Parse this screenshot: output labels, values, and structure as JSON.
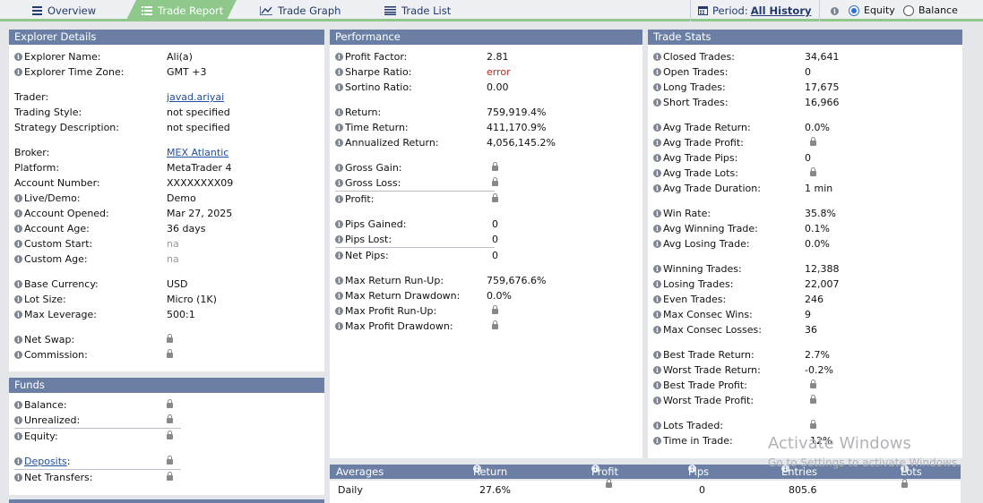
{
  "tabs": {
    "overview": "Overview",
    "trade_report": "Trade Report",
    "trade_graph": "Trade Graph",
    "trade_list": "Trade List"
  },
  "period": {
    "label": "Period:",
    "value": "All History"
  },
  "mode": {
    "equity": "Equity",
    "balance": "Balance",
    "selected": "Equity"
  },
  "explorer": {
    "title": "Explorer Details",
    "rows": {
      "explorer_name": {
        "label": "Explorer Name:",
        "value": "Ali(a)"
      },
      "explorer_tz": {
        "label": "Explorer Time Zone:",
        "value": "GMT +3"
      },
      "trader": {
        "label": "Trader:",
        "value": "javad.ariyai"
      },
      "style": {
        "label": "Trading Style:",
        "value": "not specified"
      },
      "strategy": {
        "label": "Strategy Description:",
        "value": "not specified"
      },
      "broker": {
        "label": "Broker:",
        "value": "MEX Atlantic"
      },
      "platform": {
        "label": "Platform:",
        "value": "MetaTrader 4"
      },
      "account_number": {
        "label": "Account Number:",
        "value": "XXXXXXXX09"
      },
      "live_demo": {
        "label": "Live/Demo:",
        "value": "Demo"
      },
      "opened": {
        "label": "Account Opened:",
        "value": "Mar 27, 2025"
      },
      "age": {
        "label": "Account Age:",
        "value": "36 days"
      },
      "custom_start": {
        "label": "Custom Start:",
        "value": "na"
      },
      "custom_age": {
        "label": "Custom Age:",
        "value": "na"
      },
      "base_currency": {
        "label": "Base Currency:",
        "value": "USD"
      },
      "lot_size": {
        "label": "Lot Size:",
        "value": "Micro (1K)"
      },
      "max_leverage": {
        "label": "Max Leverage:",
        "value": "500:1"
      },
      "net_swap": {
        "label": "Net Swap:"
      },
      "commission": {
        "label": "Commission:"
      }
    }
  },
  "funds": {
    "title": "Funds",
    "balance": "Balance:",
    "unrealized": "Unrealized:",
    "equity": "Equity:",
    "deposits": "Deposits",
    "deposits_colon": ":",
    "net_transfers": "Net Transfers:"
  },
  "performance": {
    "title": "Performance",
    "rows": {
      "profit_factor": {
        "label": "Profit Factor:",
        "value": "2.81"
      },
      "sharpe": {
        "label": "Sharpe Ratio:",
        "value": "error"
      },
      "sortino": {
        "label": "Sortino Ratio:",
        "value": "0.00"
      },
      "return": {
        "label": "Return:",
        "value": "759,919.4%"
      },
      "time_return": {
        "label": "Time Return:",
        "value": "411,170.9%"
      },
      "annualized": {
        "label": "Annualized Return:",
        "value": "4,056,145.2%"
      },
      "gross_gain": {
        "label": "Gross Gain:"
      },
      "gross_loss": {
        "label": "Gross Loss:"
      },
      "profit": {
        "label": "Profit:"
      },
      "pips_gained": {
        "label": "Pips Gained:",
        "value": "0"
      },
      "pips_lost": {
        "label": "Pips Lost:",
        "value": "0"
      },
      "net_pips": {
        "label": "Net Pips:",
        "value": "0"
      },
      "max_runup": {
        "label": "Max Return Run-Up:",
        "value": "759,676.6%"
      },
      "max_drawdown": {
        "label": "Max Return Drawdown:",
        "value": "0.0%"
      },
      "max_profit_runup": {
        "label": "Max Profit Run-Up:"
      },
      "max_profit_drawdown": {
        "label": "Max Profit Drawdown:"
      }
    }
  },
  "stats": {
    "title": "Trade Stats",
    "rows": {
      "closed": {
        "label": "Closed Trades:",
        "value": "34,641"
      },
      "open": {
        "label": "Open Trades:",
        "value": "0"
      },
      "long": {
        "label": "Long Trades:",
        "value": "17,675"
      },
      "short": {
        "label": "Short Trades:",
        "value": "16,966"
      },
      "avg_return": {
        "label": "Avg Trade Return:",
        "value": "0.0%"
      },
      "avg_profit": {
        "label": "Avg Trade Profit:"
      },
      "avg_pips": {
        "label": "Avg Trade Pips:",
        "value": "0"
      },
      "avg_lots": {
        "label": "Avg Trade Lots:"
      },
      "avg_duration": {
        "label": "Avg Trade Duration:",
        "value": "1 min"
      },
      "win_rate": {
        "label": "Win Rate:",
        "value": "35.8%"
      },
      "avg_winning": {
        "label": "Avg Winning Trade:",
        "value": "0.1%"
      },
      "avg_losing": {
        "label": "Avg Losing Trade:",
        "value": "0.0%"
      },
      "winning": {
        "label": "Winning Trades:",
        "value": "12,388"
      },
      "losing": {
        "label": "Losing Trades:",
        "value": "22,007"
      },
      "even": {
        "label": "Even Trades:",
        "value": "246"
      },
      "consec_wins": {
        "label": "Max Consec Wins:",
        "value": "9"
      },
      "consec_losses": {
        "label": "Max Consec Losses:",
        "value": "36"
      },
      "best_return": {
        "label": "Best Trade Return:",
        "value": "2.7%"
      },
      "worst_return": {
        "label": "Worst Trade Return:",
        "value": "-0.2%"
      },
      "best_profit": {
        "label": "Best Trade Profit:"
      },
      "worst_profit": {
        "label": "Worst Trade Profit:"
      },
      "lots_traded": {
        "label": "Lots Traded:"
      },
      "time_in_trade": {
        "label": "Time in Trade:",
        "value": "12%"
      }
    }
  },
  "averages": {
    "title": "Averages",
    "columns": {
      "return": "Return",
      "profit": "Profit",
      "pips": "Pips",
      "entries": "Entries",
      "lots": "Lots"
    },
    "daily": {
      "label": "Daily",
      "return": "27.6%",
      "pips": "0",
      "entries": "805.6"
    }
  },
  "watermark": {
    "line1": "Activate Windows",
    "line2": "Go to Settings to activate Windows."
  }
}
